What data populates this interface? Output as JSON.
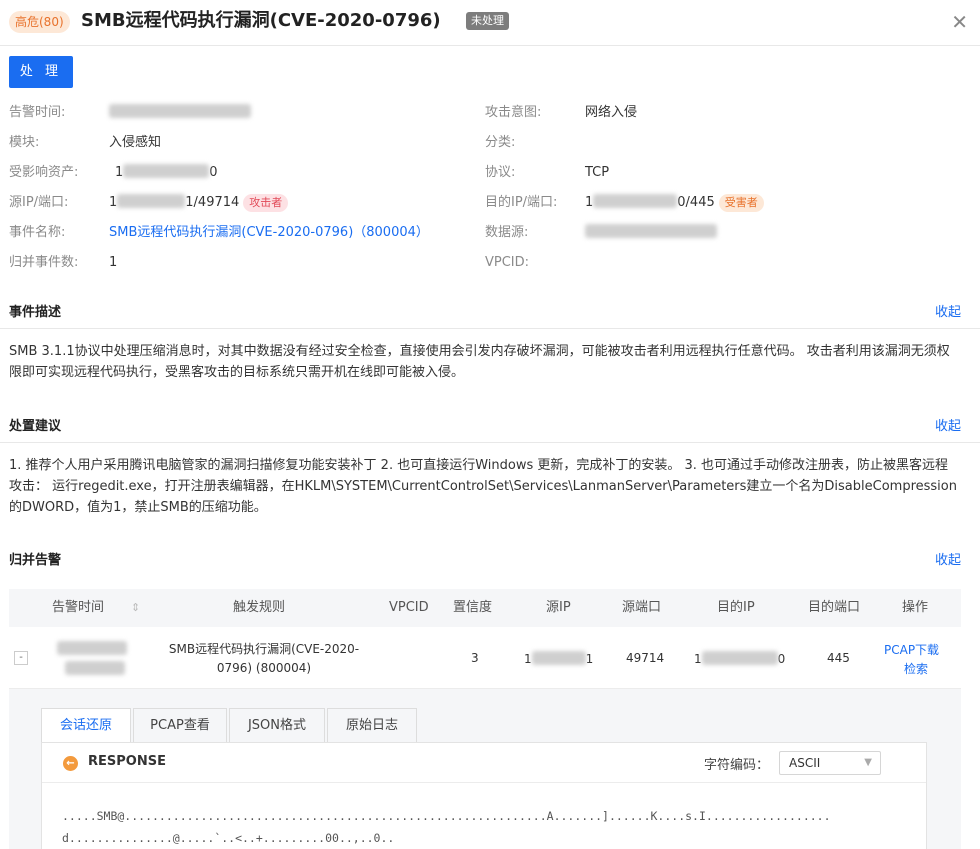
{
  "header": {
    "severity": "高危(80)",
    "title": "SMB远程代码执行漏洞(CVE-2020-0796)",
    "status": "未处理",
    "close_icon": "close-icon"
  },
  "actions": {
    "process_label": "处 理"
  },
  "details": {
    "alert_time_label": "告警时间:",
    "module_label": "模块:",
    "module_value": "入侵感知",
    "asset_label": "受影响资产:",
    "asset_prefix": "1",
    "asset_suffix": "0",
    "src_label": "源IP/端口:",
    "src_prefix": "1",
    "src_suffix": "1/49714",
    "src_tag": "攻击者",
    "event_label": "事件名称:",
    "event_value": "SMB远程代码执行漏洞(CVE-2020-0796)（800004）",
    "merged_label": "归并事件数:",
    "merged_value": "1",
    "intent_label": "攻击意图:",
    "intent_value": "网络入侵",
    "category_label": "分类:",
    "protocol_label": "协议:",
    "protocol_value": "TCP",
    "dst_label": "目的IP/端口:",
    "dst_prefix": "1",
    "dst_suffix": "0/445",
    "dst_tag": "受害者",
    "datasource_label": "数据源:",
    "vpcid_label": "VPCID:"
  },
  "description": {
    "title": "事件描述",
    "collapse": "收起",
    "text": "SMB 3.1.1协议中处理压缩消息时，对其中数据没有经过安全检查，直接使用会引发内存破坏漏洞，可能被攻击者利用远程执行任意代码。 攻击者利用该漏洞无须权限即可实现远程代码执行，受黑客攻击的目标系统只需开机在线即可能被入侵。"
  },
  "suggestion": {
    "title": "处置建议",
    "collapse": "收起",
    "text": "1. 推荐个人用户采用腾讯电脑管家的漏洞扫描修复功能安装补丁 2. 也可直接运行Windows 更新，完成补丁的安装。 3. 也可通过手动修改注册表，防止被黑客远程攻击： 运行regedit.exe，打开注册表编辑器，在HKLM\\SYSTEM\\CurrentControlSet\\Services\\LanmanServer\\Parameters建立一个名为DisableCompression的DWORD，值为1，禁止SMB的压缩功能。"
  },
  "merged_alerts": {
    "title": "归并告警",
    "collapse": "收起",
    "columns": [
      "告警时间",
      "触发规则",
      "VPCID",
      "置信度",
      "源IP",
      "源端口",
      "目的IP",
      "目的端口",
      "操作"
    ],
    "sort_icon": "sort-icon",
    "row": {
      "expand": "-",
      "rule": "SMB远程代码执行漏洞(CVE-2020-0796) (800004)",
      "confidence": "3",
      "src_ip_prefix": "1",
      "src_ip_suffix": "1",
      "src_port": "49714",
      "dst_ip_prefix": "1",
      "dst_ip_suffix": "0",
      "dst_port": "445",
      "action_pcap": "PCAP下载",
      "action_search": "检索"
    }
  },
  "detail_tabs": {
    "tabs": [
      "会话还原",
      "PCAP查看",
      "JSON格式",
      "原始日志"
    ],
    "active": 0,
    "response_title": "RESPONSE",
    "charset_label": "字符编码：",
    "charset_value": "ASCII",
    "hex_line1": ".....SMB@.............................................................A.......]......K....s.I..................",
    "hex_line2": "d...............@.....`..<..+.........00..,..0.."
  }
}
